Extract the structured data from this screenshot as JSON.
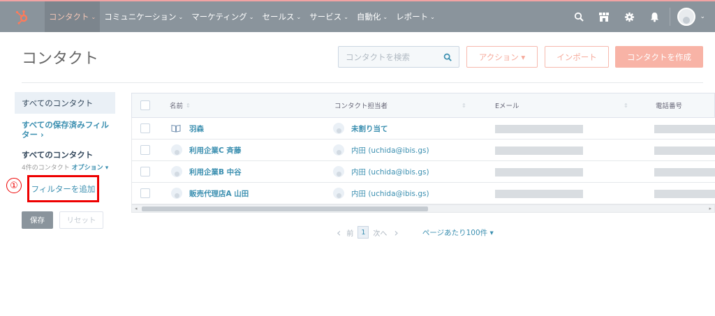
{
  "colors": {
    "accent": "#ff7a59",
    "link": "#3b8fb0",
    "nav_bg": "#8a949c",
    "annotation": "#e00000"
  },
  "nav": {
    "logo_icon": "hubspot-sprocket-icon",
    "items": [
      {
        "label": "コンタクト",
        "active": true
      },
      {
        "label": "コミュニケーション",
        "active": false
      },
      {
        "label": "マーケティング",
        "active": false
      },
      {
        "label": "セールス",
        "active": false
      },
      {
        "label": "サービス",
        "active": false
      },
      {
        "label": "自動化",
        "active": false
      },
      {
        "label": "レポート",
        "active": false
      }
    ],
    "chevron": "⌄",
    "right_icons": [
      "search-icon",
      "marketplace-icon",
      "settings-icon",
      "notifications-icon"
    ]
  },
  "header": {
    "title": "コンタクト",
    "search_placeholder": "コンタクトを検索",
    "actions_label": "アクション ▾",
    "import_label": "インポート",
    "create_label": "コンタクトを作成"
  },
  "sidebar": {
    "active_view": "すべてのコンタクト",
    "saved_filters_link": "すべての保存済みフィルター ›",
    "current_view_title": "すべてのコンタクト",
    "count_text": "4件のコンタクト",
    "options_label": "オプション ▾",
    "add_filter_label": "フィルターを追加",
    "annotation_number": "①",
    "save_label": "保存",
    "reset_label": "リセット"
  },
  "table": {
    "columns": [
      "名前",
      "コンタクト担当者",
      "Eメール",
      "電話番号"
    ],
    "rows": [
      {
        "name": "羽森",
        "owner": "未割り当て",
        "name_icon": "book-icon"
      },
      {
        "name": "利用企業C 斉藤",
        "owner": "内田 (uchida@ibis.gs)",
        "name_icon": "avatar-icon"
      },
      {
        "name": "利用企業B 中谷",
        "owner": "内田 (uchida@ibis.gs)",
        "name_icon": "avatar-icon"
      },
      {
        "name": "販売代理店A 山田",
        "owner": "内田 (uchida@ibis.gs)",
        "name_icon": "avatar-icon"
      }
    ]
  },
  "pagination": {
    "prev_label": "前",
    "current_page": "1",
    "next_label": "次へ",
    "per_page_label": "ページあたり100件 ▾"
  }
}
